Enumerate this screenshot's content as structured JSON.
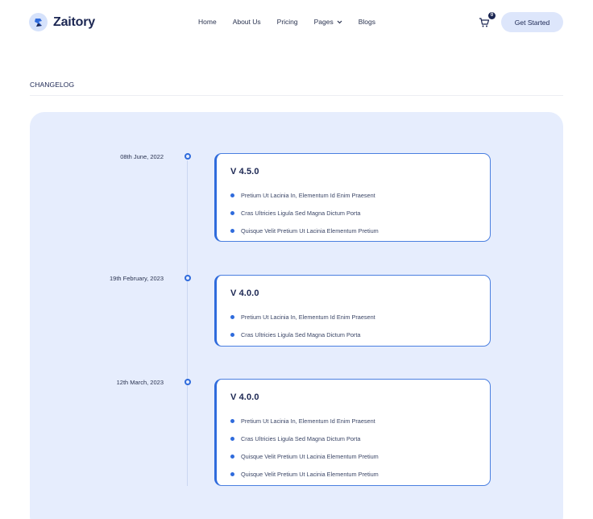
{
  "brand": {
    "name": "Zaitory"
  },
  "nav": {
    "home": "Home",
    "about": "About Us",
    "pricing": "Pricing",
    "pages": "Pages",
    "blogs": "Blogs"
  },
  "cart": {
    "count": "0"
  },
  "cta": {
    "label": "Get Started"
  },
  "section": {
    "title": "CHANGELOG"
  },
  "colors": {
    "accent": "#2f6bdc",
    "panel": "#e6edfd",
    "brand_dark": "#1b2652"
  },
  "entries": [
    {
      "date": "08th June, 2022",
      "version": "V 4.5.0",
      "items": [
        "Pretium Ut Lacinia In, Elementum Id Enim Praesent",
        "Cras Ultricies Ligula Sed Magna Dictum Porta",
        "Quisque Velit Pretium Ut Lacinia Elementum Pretium"
      ]
    },
    {
      "date": "19th February, 2023",
      "version": "V 4.0.0",
      "items": [
        "Pretium Ut Lacinia In, Elementum Id Enim Praesent",
        "Cras Ultricies Ligula Sed Magna Dictum Porta"
      ]
    },
    {
      "date": "12th March, 2023",
      "version": "V 4.0.0",
      "items": [
        "Pretium Ut Lacinia In, Elementum Id Enim Praesent",
        "Cras Ultricies Ligula Sed Magna Dictum Porta",
        "Quisque Velit Pretium Ut Lacinia Elementum Pretium",
        "Quisque Velit Pretium Ut Lacinia Elementum Pretium"
      ]
    }
  ]
}
